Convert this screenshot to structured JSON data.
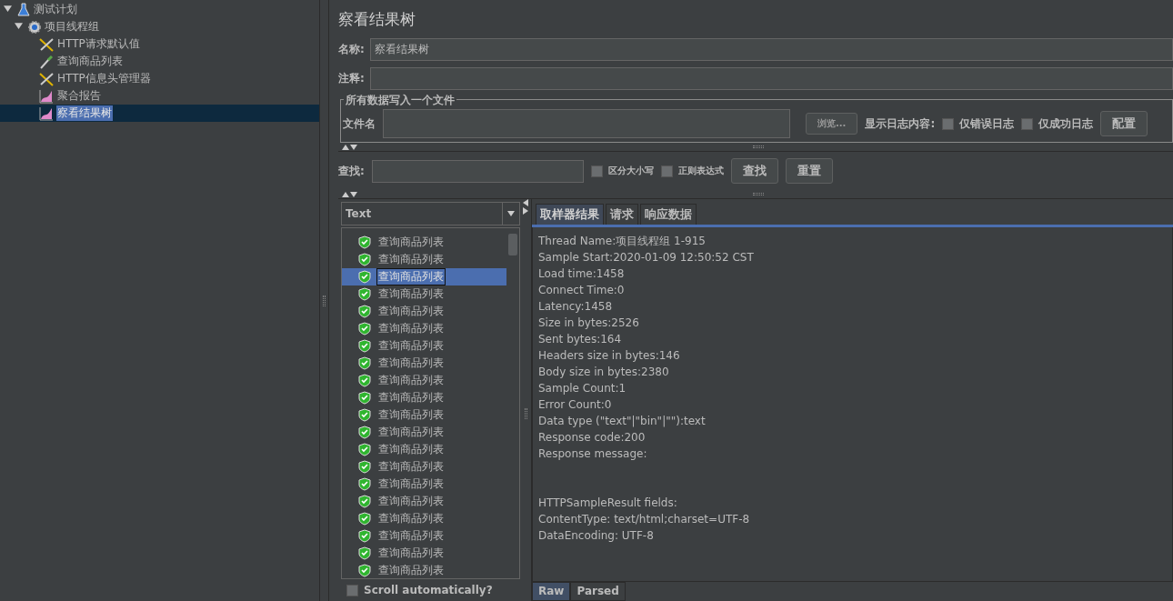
{
  "tree": [
    {
      "label": "测试计划",
      "kind": "plan",
      "expanded": true,
      "selected": false,
      "children": [
        {
          "label": "项目线程组",
          "kind": "group",
          "expanded": true,
          "selected": false,
          "children": [
            {
              "label": "HTTP请求默认值",
              "kind": "config",
              "selected": false
            },
            {
              "label": "查询商品列表",
              "kind": "sampler",
              "selected": false
            },
            {
              "label": "HTTP信息头管理器",
              "kind": "config",
              "selected": false
            },
            {
              "label": "聚合报告",
              "kind": "listener",
              "selected": false
            },
            {
              "label": "察看结果树",
              "kind": "listener",
              "selected": true
            }
          ]
        }
      ]
    }
  ],
  "panel": {
    "title": "察看结果树",
    "name_label": "名称:",
    "name_value": "察看结果树",
    "comment_label": "注释:",
    "file_group": {
      "legend": "所有数据写入一个文件",
      "file_label": "文件名",
      "browse": "浏览...",
      "log_label": "显示日志内容:",
      "errors_only": {
        "label": "仅错误日志",
        "checked": false
      },
      "success_only": {
        "label": "仅成功日志",
        "checked": false
      },
      "configure": "配置"
    },
    "search": {
      "label": "查找:",
      "case_sensitive": {
        "label": "区分大小写",
        "checked": false
      },
      "regex": {
        "label": "正则表达式",
        "checked": false
      },
      "find": "查找",
      "reset": "重置"
    },
    "renderer": "Text",
    "results": [
      {
        "label": "查询商品列表",
        "selected": false
      },
      {
        "label": "查询商品列表",
        "selected": false
      },
      {
        "label": "查询商品列表",
        "selected": true
      },
      {
        "label": "查询商品列表",
        "selected": false
      },
      {
        "label": "查询商品列表",
        "selected": false
      },
      {
        "label": "查询商品列表",
        "selected": false
      },
      {
        "label": "查询商品列表",
        "selected": false
      },
      {
        "label": "查询商品列表",
        "selected": false
      },
      {
        "label": "查询商品列表",
        "selected": false
      },
      {
        "label": "查询商品列表",
        "selected": false
      },
      {
        "label": "查询商品列表",
        "selected": false
      },
      {
        "label": "查询商品列表",
        "selected": false
      },
      {
        "label": "查询商品列表",
        "selected": false
      },
      {
        "label": "查询商品列表",
        "selected": false
      },
      {
        "label": "查询商品列表",
        "selected": false
      },
      {
        "label": "查询商品列表",
        "selected": false
      },
      {
        "label": "查询商品列表",
        "selected": false
      },
      {
        "label": "查询商品列表",
        "selected": false
      },
      {
        "label": "查询商品列表",
        "selected": false
      },
      {
        "label": "查询商品列表",
        "selected": false
      }
    ],
    "scroll_auto": {
      "label": "Scroll automatically?",
      "checked": false
    },
    "tabs": [
      {
        "label": "取样器结果",
        "selected": true
      },
      {
        "label": "请求",
        "selected": false
      },
      {
        "label": "响应数据",
        "selected": false
      }
    ],
    "detail_lines": [
      "Thread Name:项目线程组 1-915",
      "Sample Start:2020-01-09 12:50:52 CST",
      "Load time:1458",
      "Connect Time:0",
      "Latency:1458",
      "Size in bytes:2526",
      "Sent bytes:164",
      "Headers size in bytes:146",
      "Body size in bytes:2380",
      "Sample Count:1",
      "Error Count:0",
      "Data type (\"text\"|\"bin\"|\"\"):text",
      "Response code:200",
      "Response message:"
    ],
    "field_lines": [
      "HTTPSampleResult fields:",
      "ContentType: text/html;charset=UTF-8",
      "DataEncoding: UTF-8"
    ],
    "bottom_tabs": [
      {
        "label": "Raw",
        "selected": true
      },
      {
        "label": "Parsed",
        "selected": false
      }
    ]
  }
}
